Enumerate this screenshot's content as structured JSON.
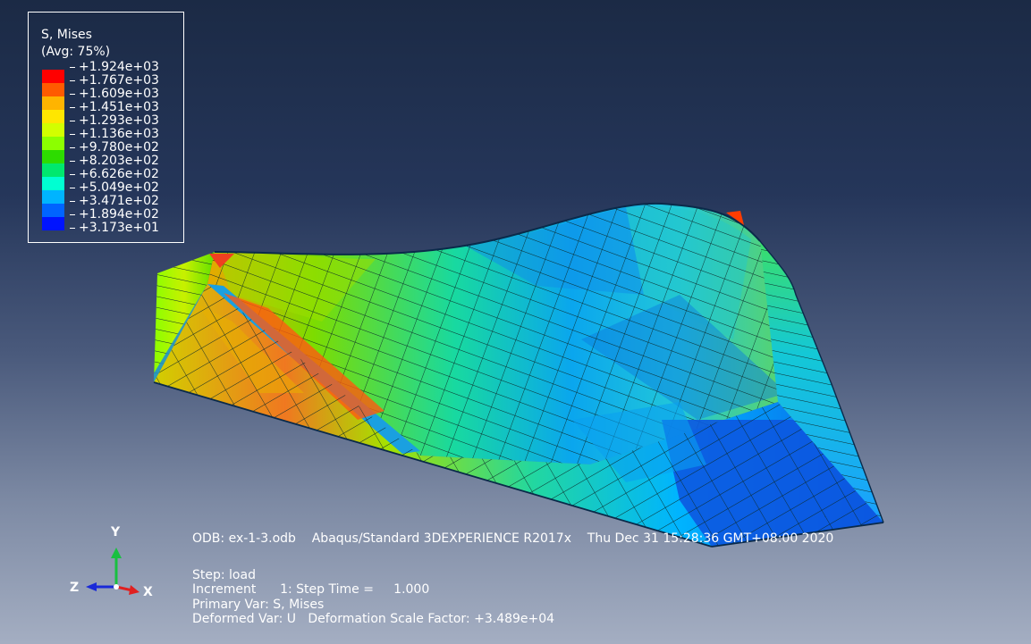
{
  "legend": {
    "title": "S, Mises",
    "subtitle": "(Avg: 75%)",
    "values": [
      "+1.924e+03",
      "+1.767e+03",
      "+1.609e+03",
      "+1.451e+03",
      "+1.293e+03",
      "+1.136e+03",
      "+9.780e+02",
      "+8.203e+02",
      "+6.626e+02",
      "+5.049e+02",
      "+3.471e+02",
      "+1.894e+02",
      "+3.173e+01"
    ],
    "colors": [
      "#ff0000",
      "#ff5a00",
      "#ffb400",
      "#ffe600",
      "#d2ff00",
      "#8cff00",
      "#2ddc00",
      "#00e86e",
      "#00ffd2",
      "#00b4ff",
      "#0064ff",
      "#0014ff"
    ]
  },
  "info": {
    "odb_line": "ODB: ex-1-3.odb    Abaqus/Standard 3DEXPERIENCE R2017x    Thu Dec 31 15:28:36 GMT+08:00 2020",
    "step_line": "Step: load",
    "increment_line": "Increment      1: Step Time =     1.000",
    "primary_line": "Primary Var: S, Mises",
    "deformed_line": "Deformed Var: U   Deformation Scale Factor: +3.489e+04"
  },
  "triad": {
    "x": "X",
    "y": "Y",
    "z": "Z"
  }
}
